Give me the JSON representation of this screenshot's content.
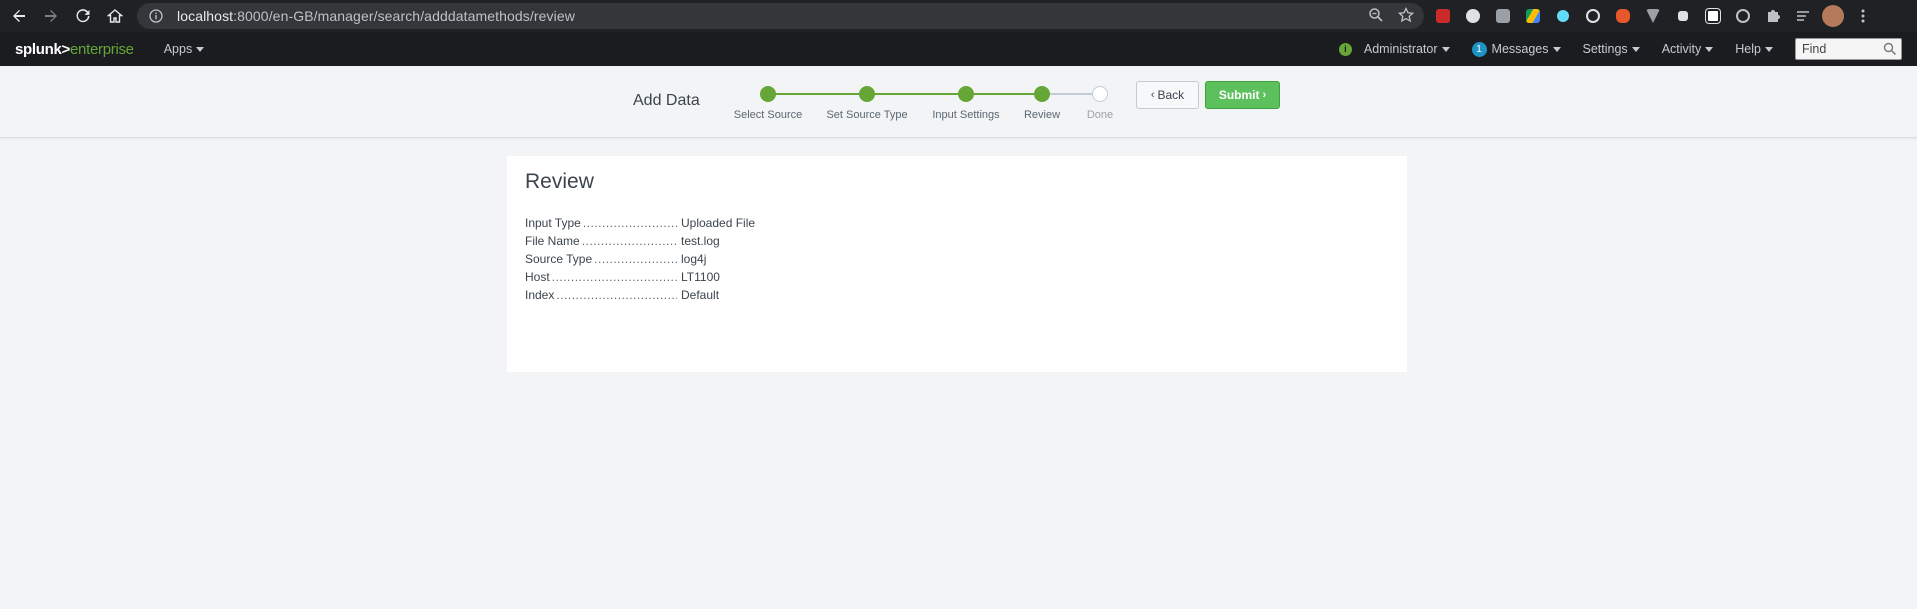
{
  "browser": {
    "url_host": "localhost",
    "url_path": ":8000/en-GB/manager/search/adddatamethods/review"
  },
  "splunkbar": {
    "logo_main": "splunk",
    "logo_gt": ">",
    "logo_sub": "enterprise",
    "apps": "Apps",
    "status_icon": "i",
    "user": "Administrator",
    "messages_count": "1",
    "messages": "Messages",
    "settings": "Settings",
    "activity": "Activity",
    "help": "Help",
    "find_placeholder": "Find"
  },
  "wizard": {
    "title": "Add Data",
    "steps": [
      {
        "label": "Select Source",
        "done": true
      },
      {
        "label": "Set Source Type",
        "done": true
      },
      {
        "label": "Input Settings",
        "done": true
      },
      {
        "label": "Review",
        "done": true
      },
      {
        "label": "Done",
        "done": false
      }
    ],
    "back_label": "Back",
    "submit_label": "Submit",
    "colors": {
      "complete": "#65a637",
      "submit": "#5cc05c"
    }
  },
  "review": {
    "title": "Review",
    "rows": [
      {
        "key": "Input Type",
        "value": "Uploaded File"
      },
      {
        "key": "File Name",
        "value": "test.log"
      },
      {
        "key": "Source Type",
        "value": "log4j"
      },
      {
        "key": "Host",
        "value": "LT1100"
      },
      {
        "key": "Index",
        "value": "Default"
      }
    ]
  }
}
